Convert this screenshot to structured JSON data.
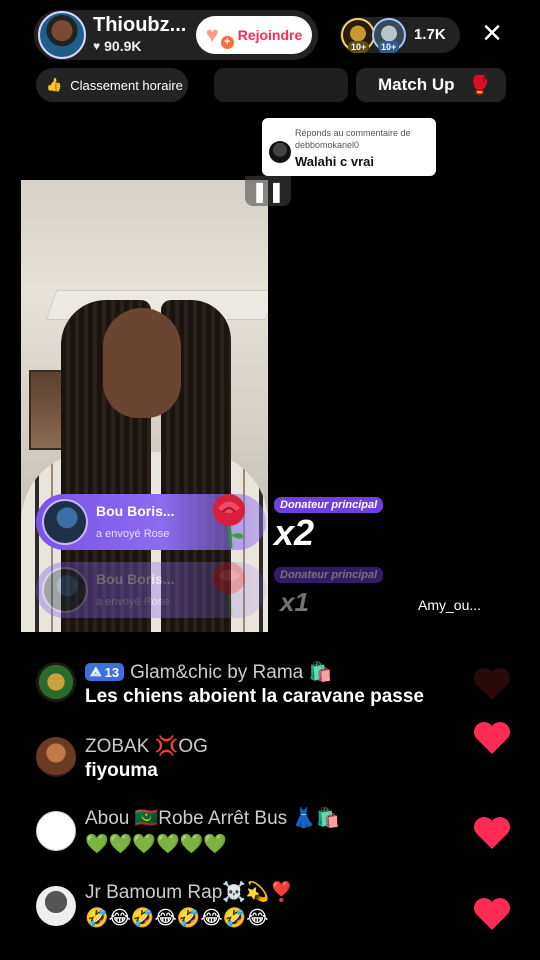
{
  "host": {
    "name": "Thioubz...",
    "likes": "90.9K",
    "join_label": "Rejoindre"
  },
  "viewers": {
    "badge_1": "10+",
    "badge_2": "10+",
    "count": "1.7K"
  },
  "close_icon": "×",
  "ranking_label": "Classement horaire",
  "match_label": "Match Up",
  "reply_card": {
    "prefix": "Réponds au commentaire de debbomokanel0",
    "text": "Walahi c vrai"
  },
  "gifts": [
    {
      "name": "Bou Boris...",
      "action": "a envoyé  Rose",
      "donor_label": "Donateur principal",
      "multiplier": "x2"
    },
    {
      "name": "Bou Boris...",
      "action": "a envoyé  Rose",
      "donor_label": "Donateur principal",
      "multiplier": "x1"
    }
  ],
  "guest_name": "Amy_ou...",
  "chat": [
    {
      "level": "13",
      "user": "Glam&chic by Rama 🛍️",
      "message": "Les chiens aboient la caravane passe"
    },
    {
      "user": "ZOBAK 💢OG",
      "message": "fiyouma"
    },
    {
      "user": "Abou 🇲🇷Robe Arrêt Bus 👗🛍️",
      "message": "💚💚💚💚💚💚"
    },
    {
      "user": "Jr Bamoum Rap☠️💫❣️",
      "message": "🤣😂🤣😂🤣😂🤣😂"
    }
  ],
  "colors": {
    "accent": "#fe2c55",
    "gift_banner": "#8c6bf0",
    "donor_label": "#6f3fe0",
    "heart": "#fe2c55"
  },
  "icons": [
    "heart-icon",
    "join-icon",
    "close-icon",
    "fire-icon",
    "boxing-gloves-icon",
    "pause-icon",
    "rose-icon",
    "level-icon",
    "like-heart-icon"
  ]
}
